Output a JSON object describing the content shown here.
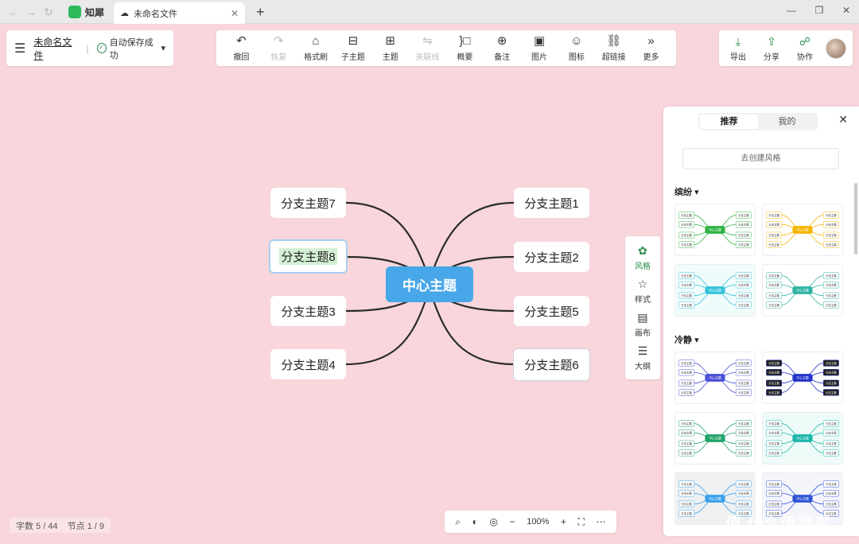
{
  "browser": {
    "app_tab": "知犀",
    "doc_tab": "未命名文件"
  },
  "file": {
    "name": "未命名文件",
    "save_status": "自动保存成功"
  },
  "toolbar": [
    {
      "label": "撤回",
      "icon": "undo-icon",
      "glyph": "↶",
      "disabled": false
    },
    {
      "label": "恢复",
      "icon": "redo-icon",
      "glyph": "↷",
      "disabled": true
    },
    {
      "label": "格式刷",
      "icon": "format-brush-icon",
      "glyph": "⌂",
      "disabled": false
    },
    {
      "label": "子主题",
      "icon": "subtopic-icon",
      "glyph": "⊟",
      "disabled": false
    },
    {
      "label": "主题",
      "icon": "topic-icon",
      "glyph": "⊞",
      "disabled": false
    },
    {
      "label": "关联线",
      "icon": "relation-line-icon",
      "glyph": "⇋",
      "disabled": true
    },
    {
      "label": "概要",
      "icon": "summary-icon",
      "glyph": "}□",
      "disabled": false
    },
    {
      "label": "备注",
      "icon": "note-icon",
      "glyph": "⊕",
      "disabled": false
    },
    {
      "label": "图片",
      "icon": "image-icon",
      "glyph": "▣",
      "disabled": false
    },
    {
      "label": "图标",
      "icon": "emoji-icon",
      "glyph": "☺",
      "disabled": false
    },
    {
      "label": "超链接",
      "icon": "link-icon",
      "glyph": "⛓",
      "disabled": false
    },
    {
      "label": "更多",
      "icon": "more-icon",
      "glyph": "»",
      "disabled": false
    }
  ],
  "share_tools": [
    {
      "label": "导出",
      "icon": "export-icon",
      "glyph": "⤓"
    },
    {
      "label": "分享",
      "icon": "share-icon",
      "glyph": "⇪"
    },
    {
      "label": "协作",
      "icon": "collaborate-icon",
      "glyph": "☍"
    }
  ],
  "mindmap": {
    "center": "中心主题",
    "branches": [
      {
        "label": "分支主题7",
        "side": "left",
        "state": "normal"
      },
      {
        "label": "分支主题8",
        "side": "left",
        "state": "selected"
      },
      {
        "label": "分支主题3",
        "side": "left",
        "state": "normal"
      },
      {
        "label": "分支主题4",
        "side": "left",
        "state": "normal"
      },
      {
        "label": "分支主题1",
        "side": "right",
        "state": "normal"
      },
      {
        "label": "分支主题2",
        "side": "right",
        "state": "normal"
      },
      {
        "label": "分支主题5",
        "side": "right",
        "state": "normal"
      },
      {
        "label": "分支主题6",
        "side": "right",
        "state": "hover"
      }
    ]
  },
  "dock": [
    {
      "label": "风格",
      "icon": "palette-icon",
      "glyph": "✿",
      "active": true
    },
    {
      "label": "样式",
      "icon": "style-icon",
      "glyph": "☆",
      "active": false
    },
    {
      "label": "画布",
      "icon": "canvas-icon",
      "glyph": "▤",
      "active": false
    },
    {
      "label": "大纲",
      "icon": "outline-icon",
      "glyph": "☰",
      "active": false
    }
  ],
  "style_panel": {
    "tabs": [
      "推荐",
      "我的"
    ],
    "active_tab": "推荐",
    "create_button": "去创建风格",
    "categories": [
      {
        "name": "缤纷"
      },
      {
        "name": "冷静"
      }
    ],
    "thumb_node_text": "分支主题",
    "thumb_center_text": "中心主题",
    "thumb_colors": [
      "#2fb344",
      "#f5b400",
      "#35c3d8",
      "#2fb3a2",
      "#4a4fd6",
      "#2233cc",
      "#1fa36a",
      "#1bb5aa",
      "#3aa0e8",
      "#2f55d6"
    ]
  },
  "status": {
    "word_count": "字数 5 / 44",
    "node_count": "节点 1 / 9"
  },
  "zoom": {
    "level": "100%"
  },
  "watermark": "值 什么值得买"
}
